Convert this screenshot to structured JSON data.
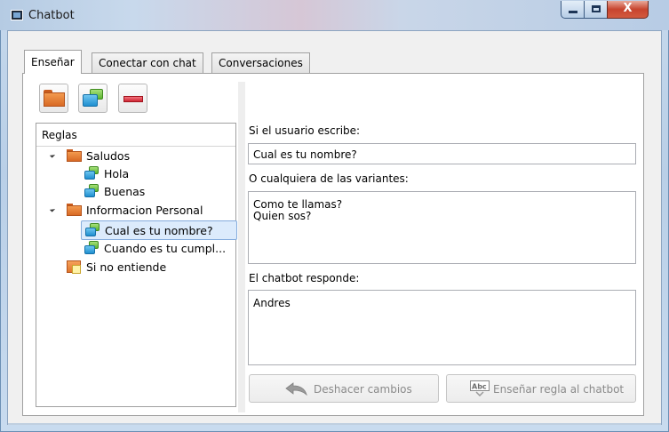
{
  "window": {
    "title": "Chatbot",
    "controls": {
      "minimize": "—",
      "maximize": "□",
      "close": "X"
    }
  },
  "tabs": [
    {
      "label": "Enseñar",
      "active": true
    },
    {
      "label": "Conectar con chat",
      "active": false
    },
    {
      "label": "Conversaciones",
      "active": false
    }
  ],
  "toolbar": {
    "buttons": [
      {
        "icon": "folder-icon"
      },
      {
        "icon": "chat-bubbles-icon"
      },
      {
        "icon": "minus-icon"
      }
    ]
  },
  "tree": {
    "header": "Reglas",
    "items": [
      {
        "label": "Saludos",
        "icon": "folder-icon",
        "level": 0,
        "expanded": true
      },
      {
        "label": "Hola",
        "icon": "chat-bubbles-icon",
        "level": 1
      },
      {
        "label": "Buenas",
        "icon": "chat-bubbles-icon",
        "level": 1
      },
      {
        "label": "Informacion Personal",
        "icon": "folder-icon",
        "level": 0,
        "expanded": true
      },
      {
        "label": "Cual es tu nombre?",
        "icon": "chat-bubbles-icon",
        "level": 1,
        "selected": true
      },
      {
        "label": "Cuando es tu cumpl...",
        "icon": "chat-bubbles-icon",
        "level": 1
      },
      {
        "label": "Si no entiende",
        "icon": "warning-note-icon",
        "level": 0
      }
    ]
  },
  "form": {
    "user_writes_label": "Si el usuario escribe:",
    "user_writes_value": "Cual es tu nombre?",
    "variants_label": "O cualquiera de las variantes:",
    "variants": [
      "Como te llamas?",
      "Quien sos?"
    ],
    "bot_responds_label": "El chatbot responde:",
    "bot_responds_value": "Andres"
  },
  "buttons": {
    "undo_label": "Deshacer cambios",
    "undo_icon": "undo-arrow-icon",
    "teach_label": "Enseñar regla al chatbot",
    "teach_icon": "spellcheck-abc-icon",
    "enabled": false
  },
  "colors": {
    "selection_bg": "#dcebfc",
    "selection_border": "#84acdd",
    "folder_orange": "#e57a32",
    "chat_green": "#6cc53c",
    "chat_blue": "#2a9ad8",
    "minus_red": "#d9303d",
    "close_red": "#c7442e"
  }
}
